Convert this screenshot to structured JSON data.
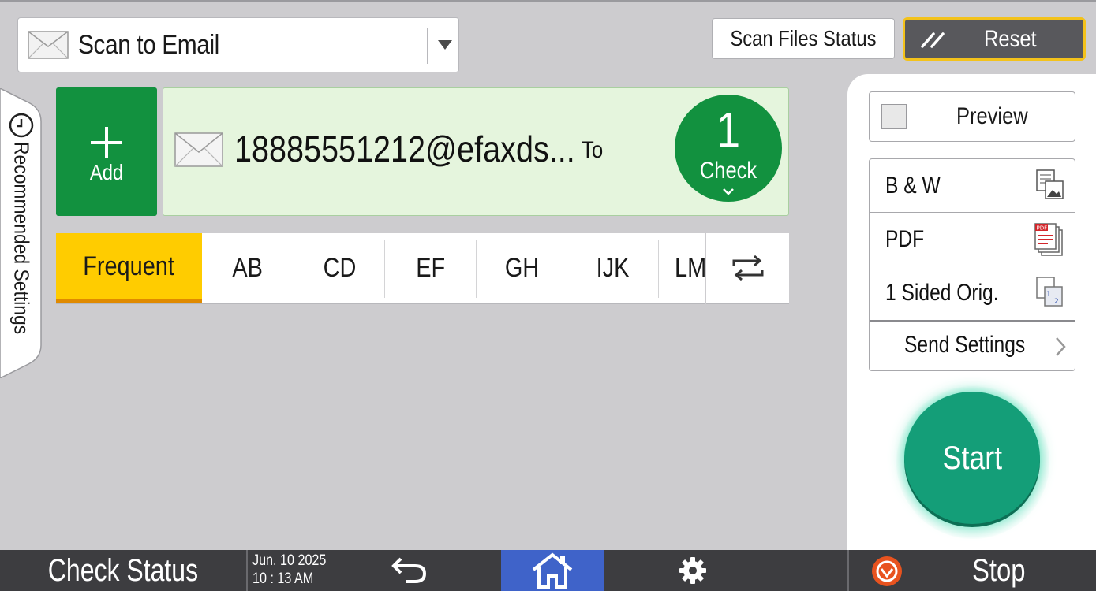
{
  "header": {
    "app_selector_label": "Scan to Email",
    "scan_files_status_label": "Scan Files Status",
    "reset_label": "Reset"
  },
  "recommended_tab": {
    "label": "Recommended Settings"
  },
  "destination": {
    "add_label": "Add",
    "address": "18885551212@efaxds...",
    "field": "To",
    "count": "1",
    "check_label": "Check"
  },
  "index_tabs": [
    {
      "label": "Frequent",
      "active": true
    },
    {
      "label": "AB",
      "active": false
    },
    {
      "label": "CD",
      "active": false
    },
    {
      "label": "EF",
      "active": false
    },
    {
      "label": "GH",
      "active": false
    },
    {
      "label": "IJK",
      "active": false
    },
    {
      "label": "LMN",
      "active": false
    }
  ],
  "settings": {
    "preview_label": "Preview",
    "rows": [
      {
        "label": "B & W",
        "icon": "bw-image-icon"
      },
      {
        "label": "PDF",
        "icon": "pdf-file-icon"
      },
      {
        "label": "1 Sided Orig.",
        "icon": "one-sided-original-icon"
      }
    ],
    "send_settings_label": "Send Settings",
    "start_label": "Start"
  },
  "bottom_bar": {
    "check_status_label": "Check Status",
    "date": "Jun. 10 2025",
    "time": "10 : 13 AM",
    "stop_label": "Stop"
  },
  "colors": {
    "background": "#cdcccf",
    "green_action": "#12913f",
    "destination_bg": "#e5f5dd",
    "active_tab": "#ffcc00",
    "start": "#149e78",
    "reset_border": "#f3c21b",
    "home_active": "#3f63c9",
    "bottom_bar": "#3d3d40"
  }
}
